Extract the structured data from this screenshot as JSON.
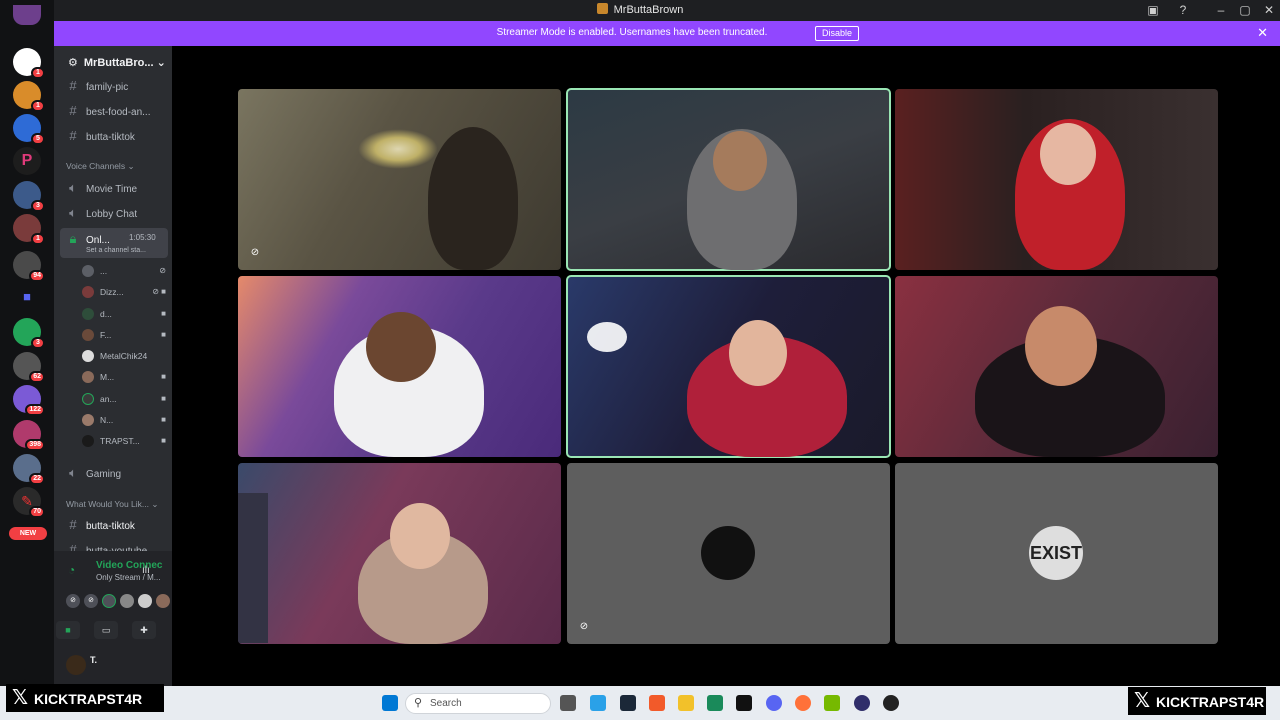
{
  "window": {
    "title": "MrButtaBrown"
  },
  "banner": {
    "message": "Streamer Mode is enabled. Usernames have been truncated.",
    "disable_label": "Disable"
  },
  "server": {
    "name": "MrButtaBro..."
  },
  "channels": {
    "text_top": [
      "family-pic",
      "best-food-an...",
      "butta-tiktok"
    ],
    "voice_category": "Voice Channels",
    "voice": [
      "Movie Time",
      "Lobby Chat"
    ],
    "active": {
      "name": "Onl...",
      "timer": "1:05:30",
      "status": "Set a channel sta..."
    },
    "voice_users": [
      "...",
      "Dizz...",
      "d...",
      "F...",
      "MetalChik24",
      "M...",
      "an...",
      "N...",
      "TRAPST..."
    ],
    "gaming": "Gaming",
    "wyl_category": "What Would You Lik...",
    "bottom": [
      "butta-tiktok",
      "butta-youtube"
    ]
  },
  "voice_panel": {
    "status": "Video Connec",
    "sub": "Only Stream / M...",
    "user_initial": "T."
  },
  "rail_badges": [
    "1",
    "1",
    "5",
    "3",
    "1",
    "94",
    "3",
    "62",
    "122",
    "398",
    "22",
    "70"
  ],
  "rail_new": "NEW",
  "tiles": [
    {
      "name": "tile-1",
      "bg": "#5d5847",
      "muted": true
    },
    {
      "name": "tile-2",
      "bg": "#3b3e44",
      "speaking": true
    },
    {
      "name": "tile-3",
      "bg": "#3a2b2c"
    },
    {
      "name": "tile-4",
      "bg": "#5a3f8a"
    },
    {
      "name": "tile-5",
      "bg": "#2a2a4a",
      "speaking": true
    },
    {
      "name": "tile-6",
      "bg": "#5a2a33"
    },
    {
      "name": "tile-7",
      "bg": "#5a3a48"
    },
    {
      "name": "tile-8",
      "bg": "#5c5c5c",
      "muted": true
    },
    {
      "name": "tile-9",
      "bg": "#5c5c5c"
    }
  ],
  "exist_avatar": "EXIST",
  "taskbar": {
    "search": "Search"
  },
  "watermark": {
    "left": "KICKTRAPST4R",
    "right": "KICKTRAPST4R"
  },
  "colors": {
    "accent": "#9147ff",
    "speaking": "#9ae6b4",
    "connected": "#23a559",
    "badge": "#f23f43"
  }
}
